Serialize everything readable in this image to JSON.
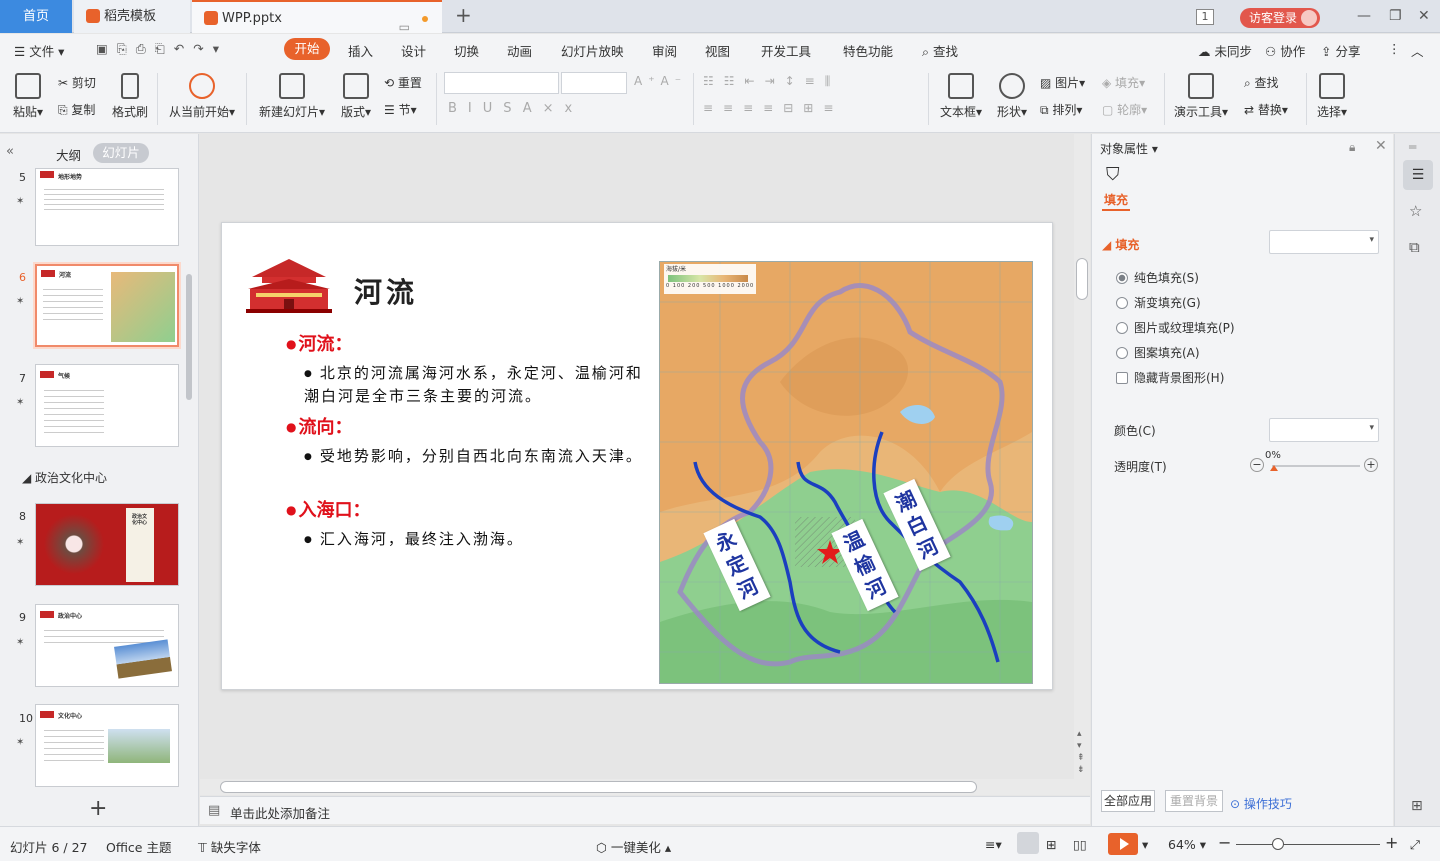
{
  "tabs": {
    "home": "首页",
    "template": "稻壳模板",
    "doc": "WPP.pptx",
    "badge": "1",
    "visitor": "访客登录"
  },
  "menu": {
    "file": "文件",
    "items": [
      "开始",
      "插入",
      "设计",
      "切换",
      "动画",
      "幻灯片放映",
      "审阅",
      "视图",
      "开发工具",
      "特色功能",
      "查找"
    ],
    "right": [
      "未同步",
      "协作",
      "分享"
    ]
  },
  "ribbon": {
    "paste": "粘贴",
    "cut": "剪切",
    "copy": "复制",
    "format_painter": "格式刷",
    "from_current": "从当前开始",
    "new_slide": "新建幻灯片",
    "layout": "版式",
    "reset": "重置",
    "section": "节",
    "textbox": "文本框",
    "shape": "形状",
    "picture": "图片",
    "fill": "填充",
    "arrange": "排列",
    "outline": "轮廓",
    "presenter": "演示工具",
    "find": "查找",
    "replace": "替换",
    "select": "选择"
  },
  "left_panel": {
    "tab_outline": "大纲",
    "tab_slides": "幻灯片",
    "section_title": "政治文化中心",
    "slides": [
      {
        "num": "5",
        "title": "地形地势"
      },
      {
        "num": "6",
        "title": "河流"
      },
      {
        "num": "7",
        "title": "气候"
      },
      {
        "num": "8",
        "title": "政治文化中心"
      },
      {
        "num": "9",
        "title": "政治中心"
      },
      {
        "num": "10",
        "title": "文化中心"
      }
    ]
  },
  "slide": {
    "title": "河流",
    "h1": "河流：",
    "p1": "北京的河流属海河水系，永定河、温榆河和潮白河是全市三条主要的河流。",
    "h2": "流向：",
    "p2": "受地势影响，分别自西北向东南流入天津。",
    "h3": "入海口：",
    "p3": "汇入海河，最终注入渤海。",
    "map_labels": [
      "永定河",
      "温榆河",
      "潮白河"
    ],
    "legend_title": "海拔/米",
    "legend_values": "0 100 200 500 1000 2000"
  },
  "notes": "单击此处添加备注",
  "right_panel": {
    "title": "对象属性",
    "tab": "填充",
    "section": "填充",
    "options": [
      "纯色填充(S)",
      "渐变填充(G)",
      "图片或纹理填充(P)",
      "图案填充(A)",
      "隐藏背景图形(H)"
    ],
    "color_label": "颜色(C)",
    "transparency_label": "透明度(T)",
    "transparency_value": "0%",
    "apply_all": "全部应用",
    "reset_bg": "重置背景",
    "tips": "操作技巧"
  },
  "status": {
    "slide": "幻灯片 6 / 27",
    "theme": "Office 主题",
    "missing_font": "缺失字体",
    "beautify": "一键美化",
    "zoom": "64%"
  },
  "colors": {
    "accent": "#e8622b",
    "blue": "#3c8ae0",
    "red_text": "#e0111b"
  }
}
